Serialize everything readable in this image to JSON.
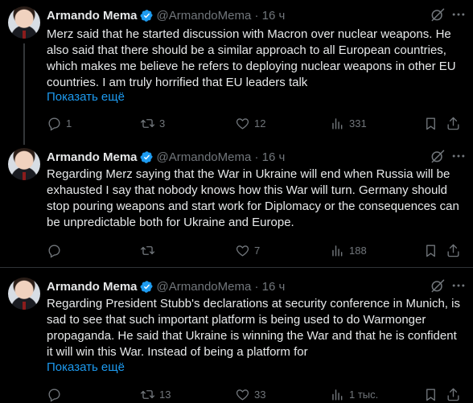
{
  "tweets": [
    {
      "name": "Armando Mema",
      "handle": "@ArmandoMema · 16 ч",
      "text": "Merz said that he started discussion with Macron over nuclear weapons. He also said that there should be a similar approach to all European countries, which makes me believe he refers to deploying nuclear weapons in other EU countries. I am truly horrified that EU leaders talk",
      "show_more": "Показать ещё",
      "replies": "1",
      "retweets": "3",
      "likes": "12",
      "views": "331"
    },
    {
      "name": "Armando Mema",
      "handle": "@ArmandoMema · 16 ч",
      "text": "Regarding Merz saying that the War in Ukraine will end when Russia will be exhausted I say that nobody knows how this War will turn. Germany should stop pouring weapons and start work for Diplomacy or the consequences can be unpredictable both for Ukraine and Europe.",
      "show_more": "",
      "replies": "",
      "retweets": "",
      "likes": "7",
      "views": "188"
    },
    {
      "name": "Armando Mema",
      "handle": "@ArmandoMema · 16 ч",
      "text": "Regarding President Stubb's declarations at security conference in Munich, is sad to see that such important platform is being used to do Warmonger propaganda. He said that Ukraine is winning the War and that he is confident it will win this War. Instead of being a platform for",
      "show_more": "Показать ещё",
      "replies": "",
      "retweets": "13",
      "likes": "33",
      "views": "1 тыс."
    }
  ],
  "colors": {
    "background": "#000000",
    "text": "#e7e9ea",
    "muted": "#71767b",
    "link": "#1d9bf0",
    "verified": "#1d9bf0",
    "divider": "#2f3336"
  },
  "icons": [
    "verified-badge-icon",
    "grok-icon",
    "more-icon",
    "reply-icon",
    "retweet-icon",
    "like-icon",
    "views-icon",
    "bookmark-icon",
    "share-icon"
  ]
}
